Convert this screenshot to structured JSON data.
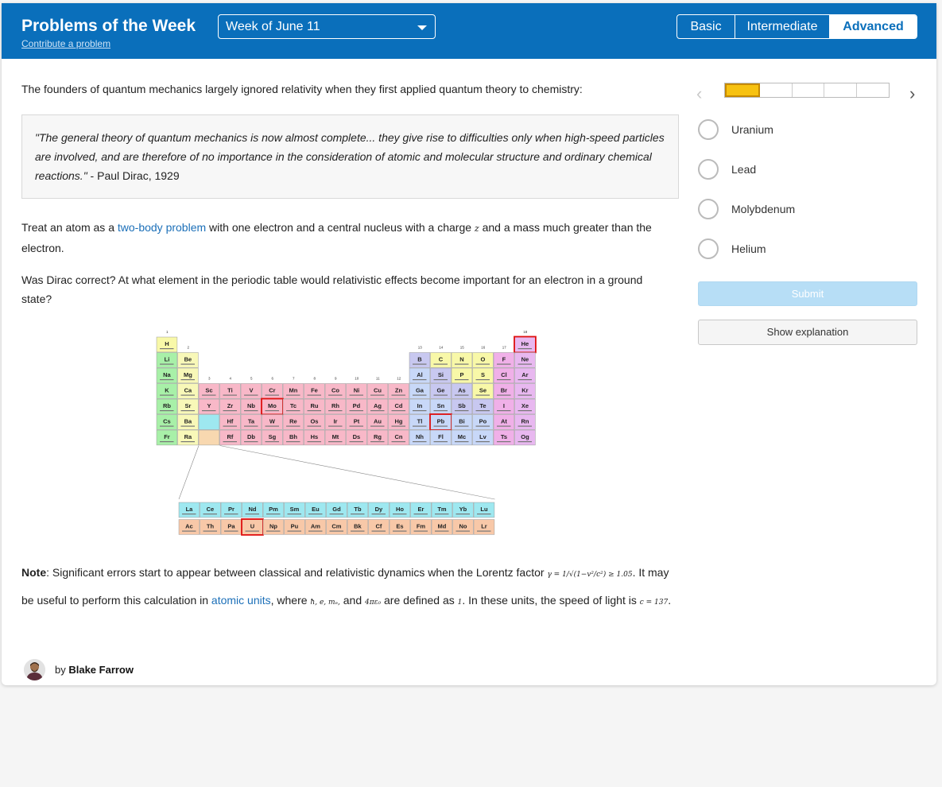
{
  "header": {
    "title": "Problems of the Week",
    "contribute_link": "Contribute a problem",
    "week_selected": "Week of June 11",
    "levels": [
      "Basic",
      "Intermediate",
      "Advanced"
    ],
    "active_level": "Advanced"
  },
  "problem": {
    "intro": "The founders of quantum mechanics largely ignored relativity when they first applied quantum theory to chemistry:",
    "quote": "\"The general theory of quantum mechanics is now almost complete... they give rise to difficulties only when high-speed particles are involved, and are therefore of no importance in the consideration of atomic and molecular structure and ordinary chemical reactions.\"",
    "quote_attribution": " - Paul Dirac, 1929",
    "para1_before": "Treat an atom as a ",
    "para1_link": "two-body problem",
    "para1_after1": " with one electron and a central nucleus with a charge ",
    "para1_z": "z",
    "para1_after2": " and a mass much greater than the electron.",
    "question": "Was Dirac correct? At what element in the periodic table would relativistic effects become important for an electron in a ground state?",
    "note_label": "Note",
    "note_text1": ": Significant errors start to appear between classical and relativistic dynamics when the Lorentz factor ",
    "note_gamma": "γ = 1/√(1−v²/c²)",
    "note_ineq": " ≥ 1.05",
    "note_text2": ". It may be useful to perform this calculation in ",
    "note_link": "atomic units",
    "note_text3": ", where ",
    "note_units": "ħ, e, mₑ,",
    "note_text4": " and ",
    "note_eps": "4πε₀",
    "note_text5": " are defined as ",
    "note_one": "1",
    "note_text6": ". In these units, the speed of light is ",
    "note_c": "c = 137",
    "note_end": "."
  },
  "periodic_table": {
    "highlighted": [
      "He",
      "Mo",
      "Pb",
      "U"
    ]
  },
  "author": {
    "by": "by ",
    "name": "Blake Farrow"
  },
  "quiz": {
    "progress": {
      "total": 5,
      "current": 1
    },
    "options": [
      "Uranium",
      "Lead",
      "Molybdenum",
      "Helium"
    ],
    "submit_label": "Submit",
    "explanation_label": "Show explanation",
    "prev_icon": "‹",
    "next_icon": "›"
  }
}
